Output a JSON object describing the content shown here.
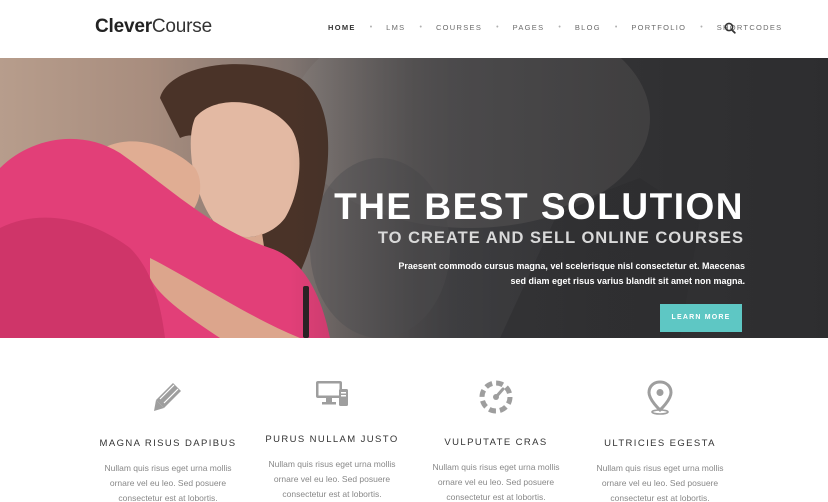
{
  "header": {
    "logo_bold": "Clever",
    "logo_light": "Course",
    "nav": [
      {
        "label": "HOME",
        "active": true
      },
      {
        "label": "LMS",
        "active": false
      },
      {
        "label": "COURSES",
        "active": false
      },
      {
        "label": "PAGES",
        "active": false
      },
      {
        "label": "BLOG",
        "active": false
      },
      {
        "label": "PORTFOLIO",
        "active": false
      },
      {
        "label": "SHORTCODES",
        "active": false
      }
    ],
    "search_icon": "search-icon"
  },
  "hero": {
    "title": "THE BEST SOLUTION",
    "subtitle": "TO CREATE AND SELL ONLINE COURSES",
    "text": "Praesent commodo cursus magna, vel scelerisque nisl consectetur et. Maecenas sed diam eget risus varius blandit sit amet non magna.",
    "button": "LEARN MORE",
    "button_color": "#5ec7c4"
  },
  "features": [
    {
      "icon": "pencil-icon",
      "title": "MAGNA RISUS DAPIBUS",
      "desc": "Nullam quis risus eget urna mollis ornare vel eu leo. Sed posuere consectetur est at lobortis."
    },
    {
      "icon": "desktop-icon",
      "title": "PURUS NULLAM JUSTO",
      "desc": "Nullam quis risus eget urna mollis ornare vel eu leo. Sed posuere consectetur est at lobortis."
    },
    {
      "icon": "dashboard-icon",
      "title": "VULPUTATE CRAS",
      "desc": "Nullam quis risus eget urna mollis ornare vel eu leo. Sed posuere consectetur est at lobortis."
    },
    {
      "icon": "map-pin-icon",
      "title": "ULTRICIES EGESTA",
      "desc": "Nullam quis risus eget urna mollis ornare vel eu leo. Sed posuere consectetur est at lobortis."
    }
  ]
}
